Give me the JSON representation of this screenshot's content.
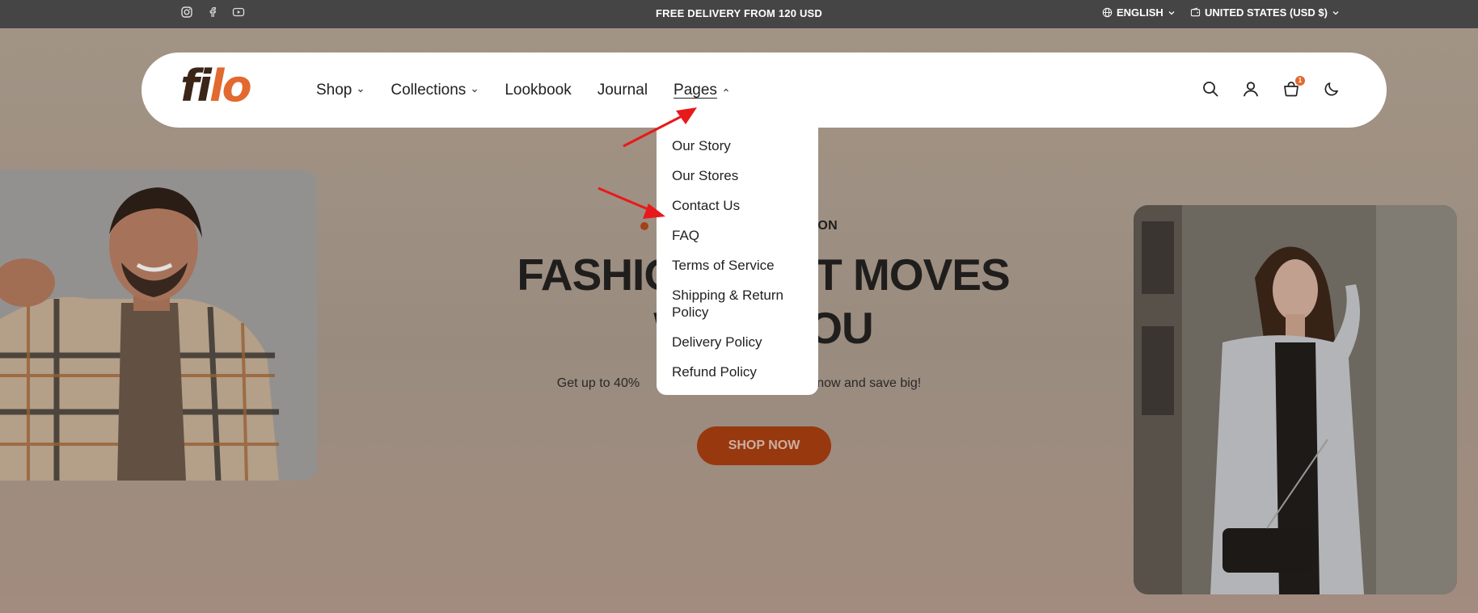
{
  "topbar": {
    "social_icons": [
      "instagram-icon",
      "facebook-icon",
      "youtube-icon"
    ],
    "promo": "FREE DELIVERY FROM 120 USD",
    "language": "ENGLISH",
    "currency": "UNITED STATES (USD $)"
  },
  "header": {
    "logo": {
      "part1": "fi",
      "part2": "lo"
    },
    "nav": [
      {
        "label": "Shop",
        "has_dropdown": true
      },
      {
        "label": "Collections",
        "has_dropdown": true
      },
      {
        "label": "Lookbook",
        "has_dropdown": false
      },
      {
        "label": "Journal",
        "has_dropdown": false
      },
      {
        "label": "Pages",
        "has_dropdown": true,
        "open": true
      }
    ],
    "icons": [
      "search-icon",
      "account-icon",
      "cart-icon",
      "theme-toggle-icon"
    ],
    "cart_count": "1"
  },
  "dropdown": {
    "items": [
      "Our Story",
      "Our Stores",
      "Contact Us",
      "FAQ",
      "Terms of Service",
      "Shipping & Return Policy",
      "Delivery Policy",
      "Refund Policy"
    ]
  },
  "hero": {
    "badge": "DS SOON",
    "headline_line1": "FASHIO",
    "headline_line1b": "T MOVES",
    "headline_line2a": "W",
    "headline_line2b": "OU",
    "subtext_a": "Get up to 40%",
    "subtext_b": "hop now and save big!",
    "cta": "SHOP NOW"
  },
  "colors": {
    "accent": "#e2692f",
    "cta": "#a83d10",
    "topbar": "#454545",
    "arrow": "#e8191b"
  }
}
